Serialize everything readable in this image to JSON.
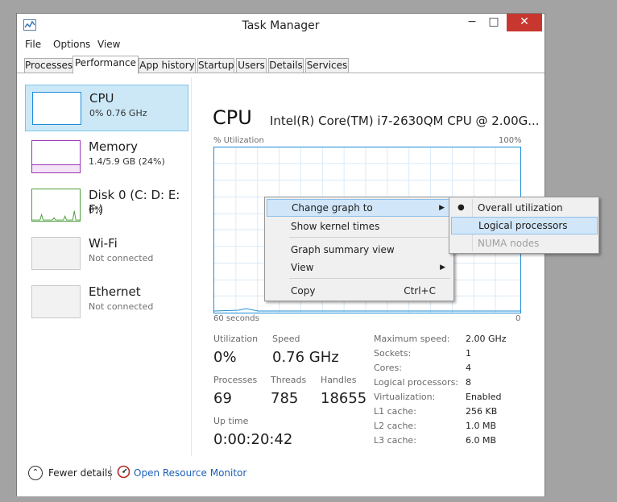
{
  "window": {
    "title": "Task Manager",
    "minimize": "−",
    "maximize": "□",
    "close": "✕"
  },
  "menu": [
    "File",
    "Options",
    "View"
  ],
  "tabs": [
    "Processes",
    "Performance",
    "App history",
    "Startup",
    "Users",
    "Details",
    "Services"
  ],
  "active_tab": "Performance",
  "sidebar": [
    {
      "title": "CPU",
      "sub": "0% 0.76 GHz",
      "selected": true
    },
    {
      "title": "Memory",
      "sub": "1.4/5.9 GB (24%)"
    },
    {
      "title": "Disk 0 (C: D: E: F:)",
      "sub": "0%"
    },
    {
      "title": "Wi-Fi",
      "sub": "Not connected"
    },
    {
      "title": "Ethernet",
      "sub": "Not connected"
    }
  ],
  "main": {
    "title": "CPU",
    "cpu_name": "Intel(R) Core(TM) i7-2630QM CPU @ 2.00G...",
    "chart_ylabel": "% Utilization",
    "chart_ymax": "100%",
    "chart_xlabel": "60 seconds",
    "chart_xmin": "0"
  },
  "stats": {
    "utilization_label": "Utilization",
    "utilization_value": "0%",
    "speed_label": "Speed",
    "speed_value": "0.76 GHz",
    "processes_label": "Processes",
    "processes_value": "69",
    "threads_label": "Threads",
    "threads_value": "785",
    "handles_label": "Handles",
    "handles_value": "18655",
    "uptime_label": "Up time",
    "uptime_value": "0:00:20:42"
  },
  "specs": [
    {
      "label": "Maximum speed:",
      "value": "2.00 GHz"
    },
    {
      "label": "Sockets:",
      "value": "1"
    },
    {
      "label": "Cores:",
      "value": "4"
    },
    {
      "label": "Logical processors:",
      "value": "8"
    },
    {
      "label": "Virtualization:",
      "value": "Enabled"
    },
    {
      "label": "L1 cache:",
      "value": "256 KB"
    },
    {
      "label": "L2 cache:",
      "value": "1.0 MB"
    },
    {
      "label": "L3 cache:",
      "value": "6.0 MB"
    }
  ],
  "footer": {
    "fewer_details": "Fewer details",
    "resource_monitor": "Open Resource Monitor"
  },
  "context_menu": {
    "change_graph": "Change graph to",
    "show_kernel": "Show kernel times",
    "summary_view": "Graph summary view",
    "view": "View",
    "copy": "Copy",
    "copy_shortcut": "Ctrl+C"
  },
  "submenu": {
    "overall": "Overall utilization",
    "logical": "Logical processors",
    "numa": "NUMA nodes"
  },
  "colors": {
    "cpu": "#1d8dd8",
    "memory": "#9b34b3",
    "disk": "#4ca03c",
    "selection": "#cce8f7",
    "close": "#c7372f"
  }
}
